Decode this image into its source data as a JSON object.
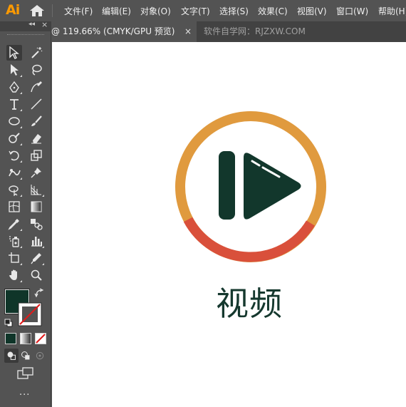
{
  "app": {
    "logo": "Ai"
  },
  "menu": {
    "items": [
      "文件(F)",
      "编辑(E)",
      "对象(O)",
      "文字(T)",
      "选择(S)",
      "效果(C)",
      "视图(V)",
      "窗口(W)",
      "帮助(H)"
    ]
  },
  "tabs": {
    "active": {
      "title": "@ 119.66% (CMYK/GPU 预览)",
      "close": "×"
    },
    "inactive": {
      "title": "软件自学网：RJZXW.COM"
    }
  },
  "panel": {
    "collapse": "◂◂",
    "close": "×",
    "more": "..."
  },
  "colors": {
    "fill": "#0f3529",
    "ring_top": "#e09a3e",
    "ring_bottom": "#d9503b",
    "icon_dark": "#12372c",
    "text": "#15382e"
  },
  "artwork": {
    "label": "视频"
  }
}
